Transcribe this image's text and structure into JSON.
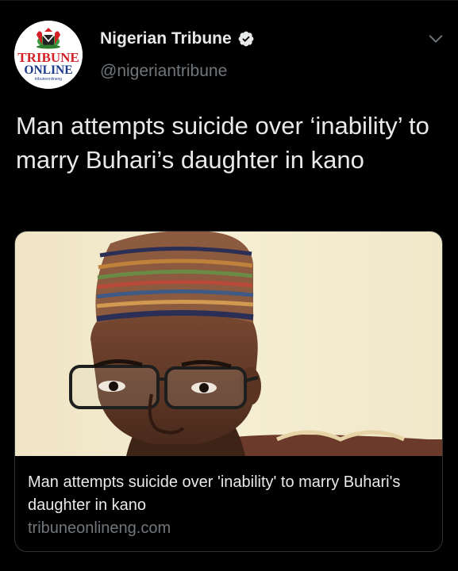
{
  "account": {
    "display_name": "Nigerian Tribune",
    "handle": "@nigeriantribune",
    "verified": true,
    "avatar_logo_text": [
      "TRIBUNE",
      "ONLINE",
      "tribuneonlineng"
    ]
  },
  "tweet": {
    "text": "Man attempts suicide over ‘inability’ to marry Buhari’s daughter in kano"
  },
  "link_card": {
    "title": "Man attempts suicide over 'inability' to marry Buhari's daughter in kano",
    "domain": "tribuneonlineng.com",
    "image": "photo-of-man-in-embroidered-cap-and-glasses"
  },
  "icons": {
    "verified": "verified-badge-icon",
    "menu": "chevron-down-icon"
  },
  "colors": {
    "background": "#000000",
    "primary_text": "#e7e9ea",
    "secondary_text": "#71767b",
    "border": "#2f3336",
    "logo_red": "#d32027",
    "logo_blue": "#1b3a8a"
  }
}
